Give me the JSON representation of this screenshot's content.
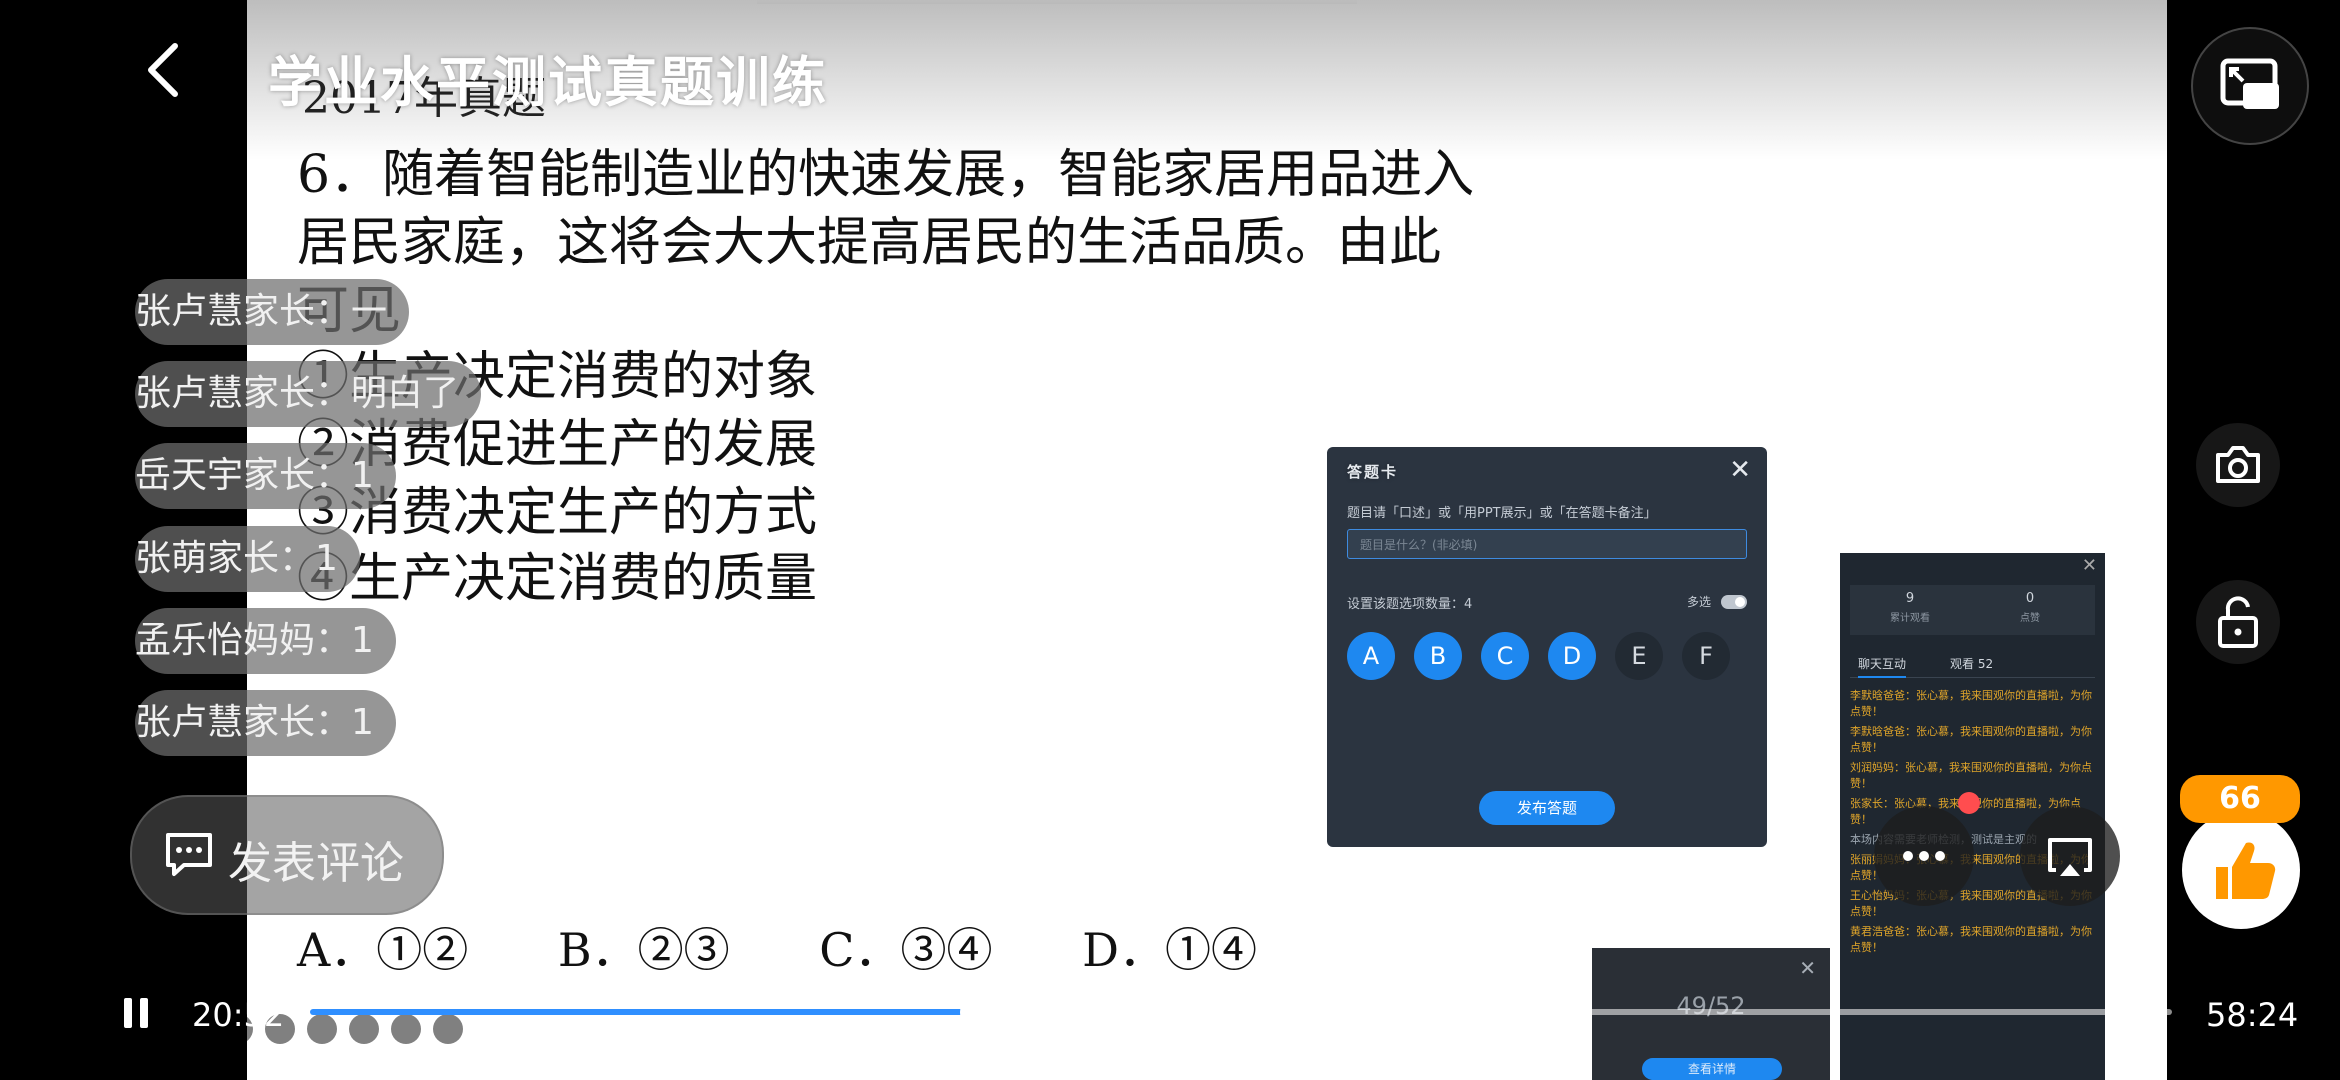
{
  "header": {
    "title": "学业水平测试真题训练"
  },
  "slide": {
    "year": "2017年真题",
    "question_lines": [
      "6．随着智能制造业的快速发展，智能家居用品进入",
      "居民家庭，这将会大大提高居民的生活品质。由此",
      "可见"
    ],
    "items": [
      "①生产决定消费的对象",
      "②消费促进生产的发展",
      "③消费决定生产的方式",
      "④生产决定消费的质量"
    ],
    "answers": [
      "A．①②",
      "B．②③",
      "C．③④",
      "D．①④"
    ]
  },
  "answer_card": {
    "title": "答题卡",
    "close": "✕",
    "hint": "题目请「口述」或「用PPT展示」或「在答题卡备注」",
    "input_placeholder": "题目是什么？(非必填)",
    "option_count_label": "设置该题选项数量：4",
    "multi_label": "多选",
    "options": [
      "A",
      "B",
      "C",
      "D",
      "E",
      "F"
    ],
    "publish": "发布答题"
  },
  "chat_panel": {
    "stats": [
      {
        "value": "9",
        "label": "累计观看"
      },
      {
        "value": "0",
        "label": "点赞"
      }
    ],
    "tabs": [
      "聊天互动",
      "观看 52"
    ],
    "messages": [
      "李默晗爸爸：张心慕，我来围观你的直播啦，为你点赞！",
      "李默晗爸爸：张心慕，我来围观你的直播啦，为你点赞！",
      "刘润妈妈：张心慕，我来围观你的直播啦，为你点赞！",
      "张家长：张心慕，我来围观你的直播啦，为你点赞！",
      "张丽娟妈妈：张心慕，我来围观你的直播啦，为你点赞！",
      "王心怡妈妈：张心慕，我来围观你的直播啦，为你点赞！",
      "黄君浩爸爸：张心慕，我来围观你的直播啦，为你点赞！"
    ],
    "system_msg": "本场内容需要老师检测，测试是主观的"
  },
  "progress_panel": {
    "count": "49/52",
    "button": "查看详情"
  },
  "danmu": [
    {
      "text": "张卢慧家长：一"
    },
    {
      "text": "张卢慧家长：明白了"
    },
    {
      "text": "岳天宇家长：1"
    },
    {
      "text": "张萌家长：1"
    },
    {
      "text": "孟乐怡妈妈：1"
    },
    {
      "text": "张卢慧家长：1"
    }
  ],
  "comment": {
    "label": "发表评论"
  },
  "like": {
    "count": "66"
  },
  "player": {
    "current_time": "20:52",
    "total_time": "58:24",
    "progress": 0.36
  },
  "colors": {
    "accent": "#2f8fff",
    "like": "#ff9800"
  }
}
